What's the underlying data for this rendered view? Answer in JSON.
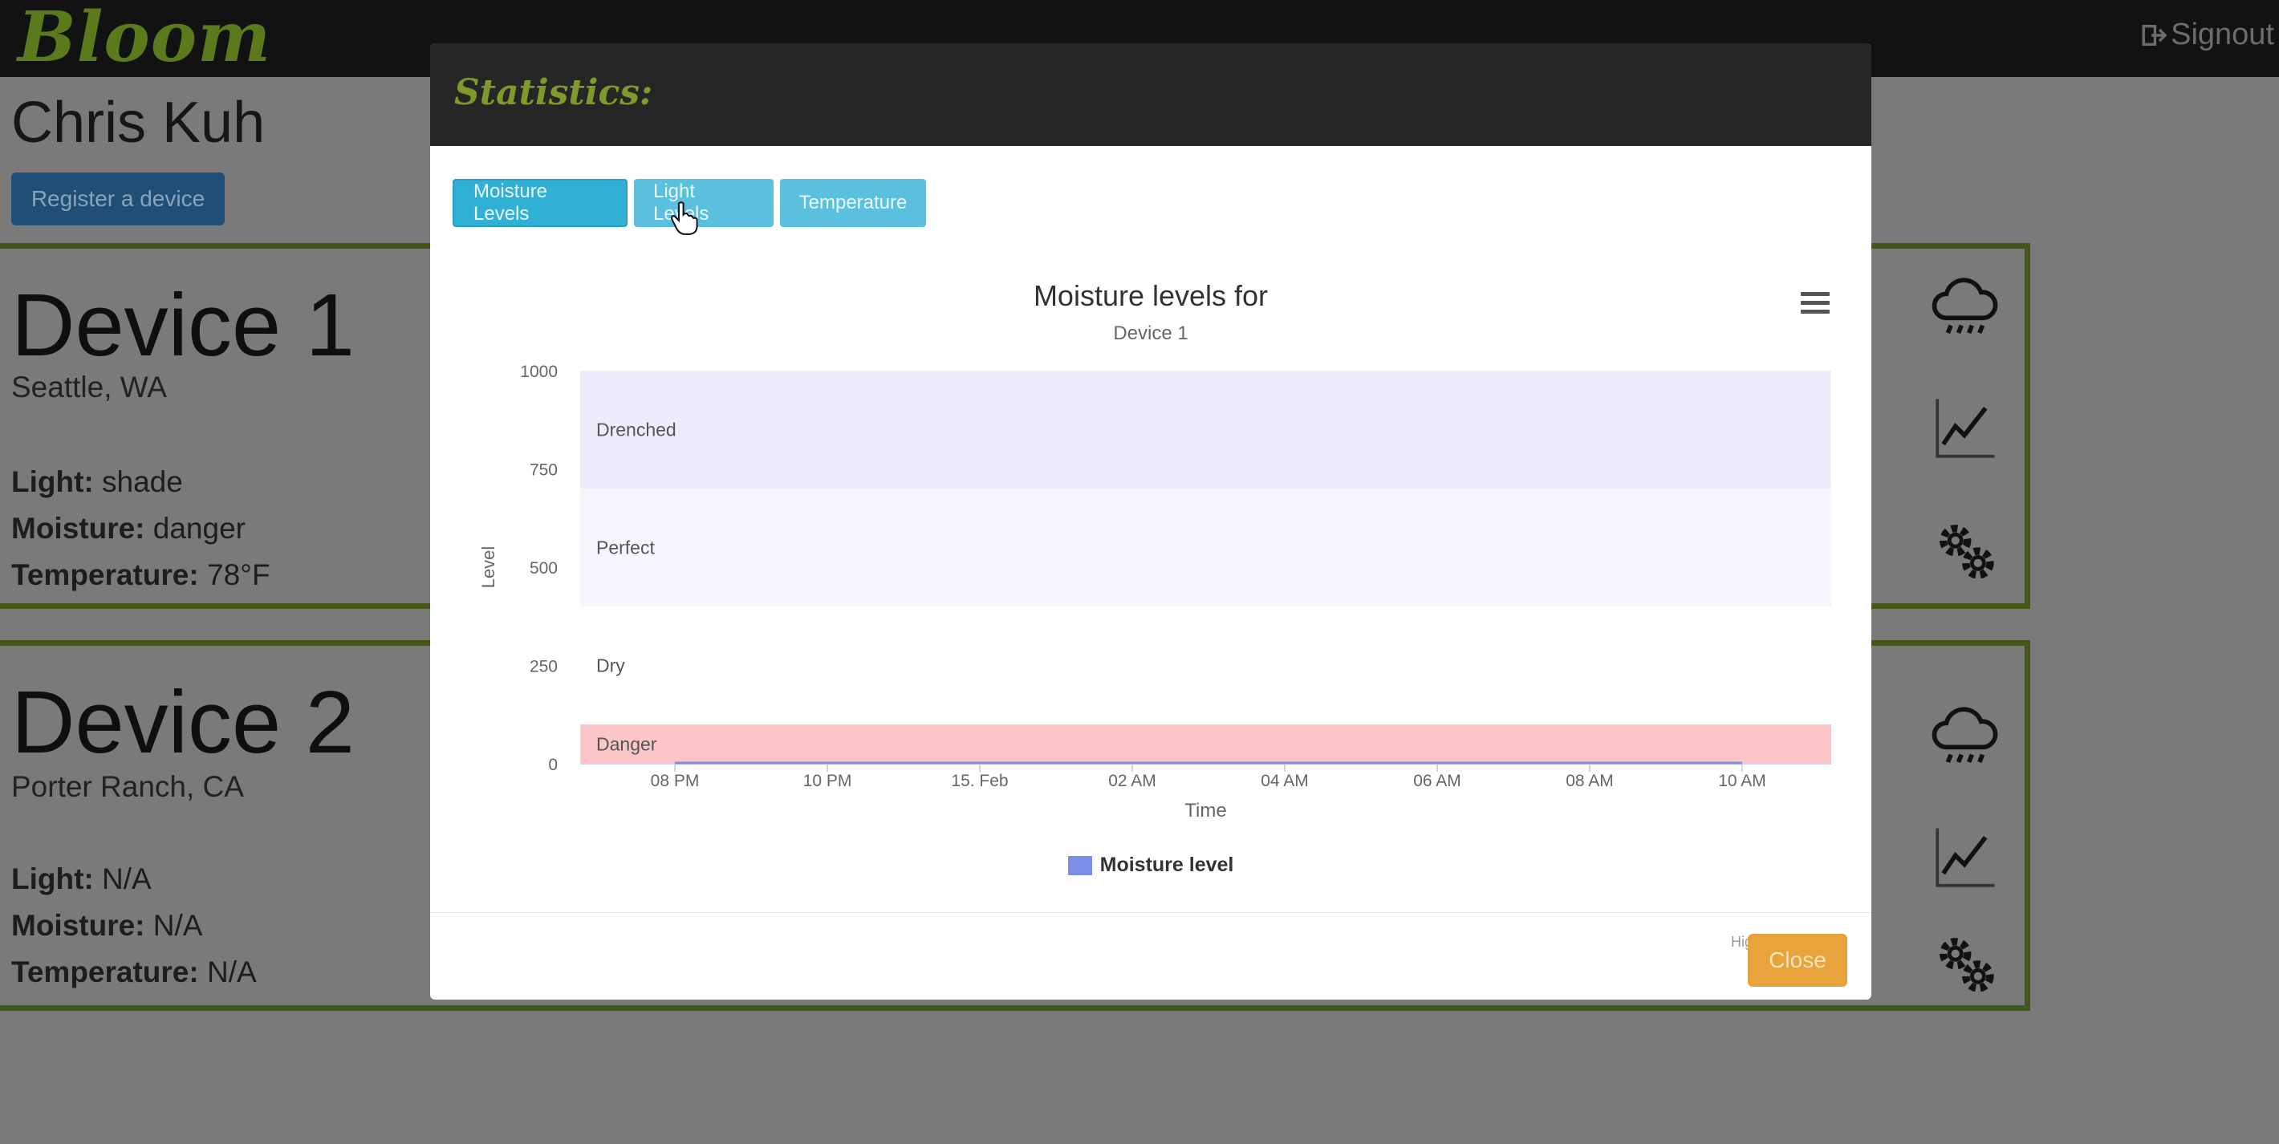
{
  "navbar": {
    "brand": "Bloom",
    "signout_label": "Signout"
  },
  "user": {
    "name": "Chris Kuh",
    "register_label": "Register a device"
  },
  "devices": [
    {
      "name": "Device 1",
      "location": "Seattle, WA",
      "light_label": "Light:",
      "light_value": "shade",
      "moisture_label": "Moisture:",
      "moisture_value": "danger",
      "temperature_label": "Temperature:",
      "temperature_value": "78°F"
    },
    {
      "name": "Device 2",
      "location": "Porter Ranch, CA",
      "light_label": "Light:",
      "light_value": "N/A",
      "moisture_label": "Moisture:",
      "moisture_value": "N/A",
      "temperature_label": "Temperature:",
      "temperature_value": "N/A"
    }
  ],
  "modal": {
    "title": "Statistics:",
    "tabs": [
      {
        "label": "Moisture Levels",
        "active": true
      },
      {
        "label": "Light Levels",
        "active": false
      },
      {
        "label": "Temperature",
        "active": false
      }
    ],
    "close_label": "Close",
    "credits": "Highcharts.com"
  },
  "chart_data": {
    "type": "line",
    "title": "Moisture levels for",
    "subtitle": "Device 1",
    "xlabel": "Time",
    "ylabel": "Level",
    "ylim": [
      0,
      1000
    ],
    "y_ticks": [
      0,
      250,
      500,
      750,
      1000
    ],
    "x_ticks": [
      "08 PM",
      "10 PM",
      "15. Feb",
      "02 AM",
      "04 AM",
      "06 AM",
      "08 AM",
      "10 AM"
    ],
    "bands": [
      {
        "label": "Drenched",
        "from": 700,
        "to": 1000,
        "color": "#ececfb"
      },
      {
        "label": "Perfect",
        "from": 400,
        "to": 700,
        "color": "#f5f5fd"
      },
      {
        "label": "Dry",
        "from": 100,
        "to": 400,
        "color": "#ffffff"
      },
      {
        "label": "Danger",
        "from": 0,
        "to": 100,
        "color": "#fcc5c7"
      }
    ],
    "series": [
      {
        "name": "Moisture level",
        "color": "#7b8ee6",
        "x_range": [
          "08 PM",
          "10 AM"
        ],
        "values": [
          0,
          0
        ]
      }
    ],
    "legend_position": "bottom-center",
    "grid": false
  }
}
